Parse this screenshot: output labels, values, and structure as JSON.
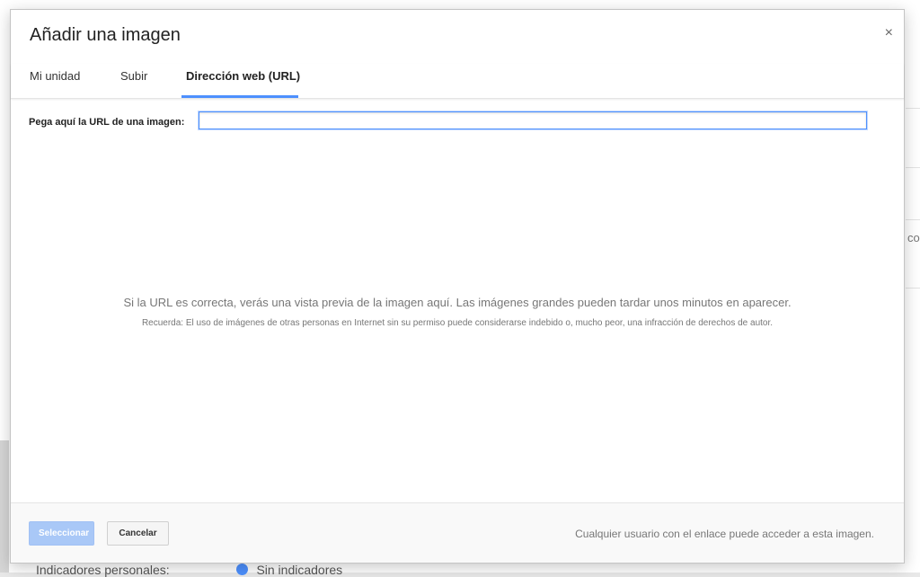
{
  "background": {
    "right_edge_text": "co",
    "bottom_label": "Indicadores personales:",
    "bottom_option": "Sin indicadores"
  },
  "dialog": {
    "title": "Añadir una imagen",
    "close_label": "×",
    "tabs": [
      {
        "label": "Mi unidad",
        "active": false
      },
      {
        "label": "Subir",
        "active": false
      },
      {
        "label": "Dirección web (URL)",
        "active": true
      }
    ],
    "url_field": {
      "label": "Pega aquí la URL de una imagen:",
      "value": ""
    },
    "preview_message": "Si la URL es correcta, verás una vista previa de la imagen aquí. Las imágenes grandes pueden tardar unos minutos en aparecer.",
    "preview_note": "Recuerda: El uso de imágenes de otras personas en Internet sin su permiso puede considerarse indebido o, mucho peor, una infracción de derechos de autor.",
    "footer": {
      "select_label": "Seleccionar",
      "select_enabled": false,
      "cancel_label": "Cancelar",
      "sharing_note": "Cualquier usuario con el enlace puede acceder a esta imagen."
    }
  },
  "colors": {
    "accent": "#4d90fe",
    "disabled_primary": "#a9c8f7",
    "muted_text": "#777777"
  }
}
